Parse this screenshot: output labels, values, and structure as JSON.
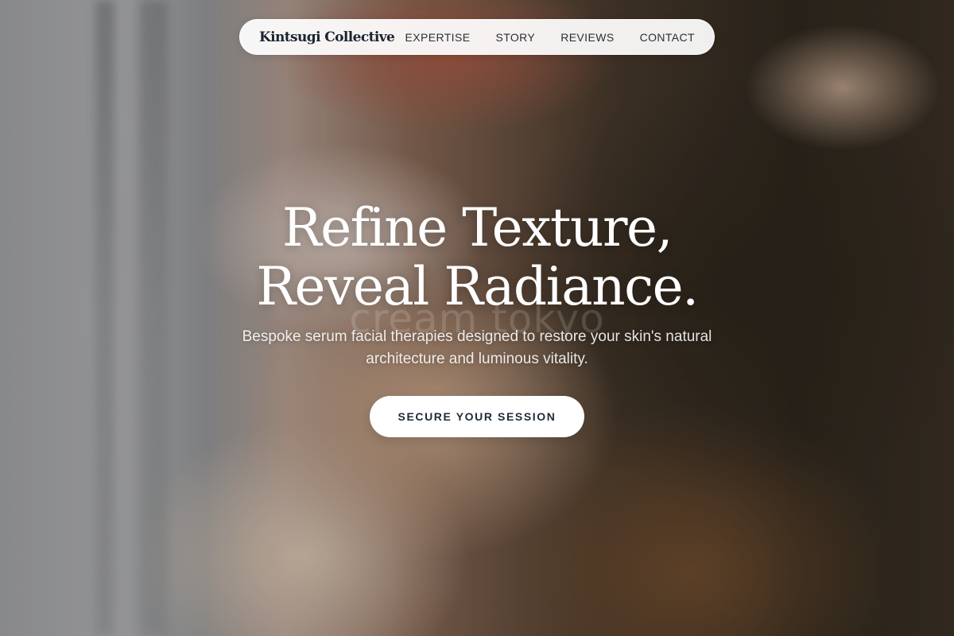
{
  "nav": {
    "brand": "Kintsugi Collective",
    "links": [
      "EXPERTISE",
      "STORY",
      "REVIEWS",
      "CONTACT"
    ]
  },
  "hero": {
    "headline_line1": "Refine Texture,",
    "headline_line2": "Reveal Radiance.",
    "subtitle": "Bespoke serum facial therapies designed to restore your skin's natural architecture and luminous vitality.",
    "cta_label": "SECURE YOUR SESSION",
    "watermark": "cream tokyo"
  }
}
